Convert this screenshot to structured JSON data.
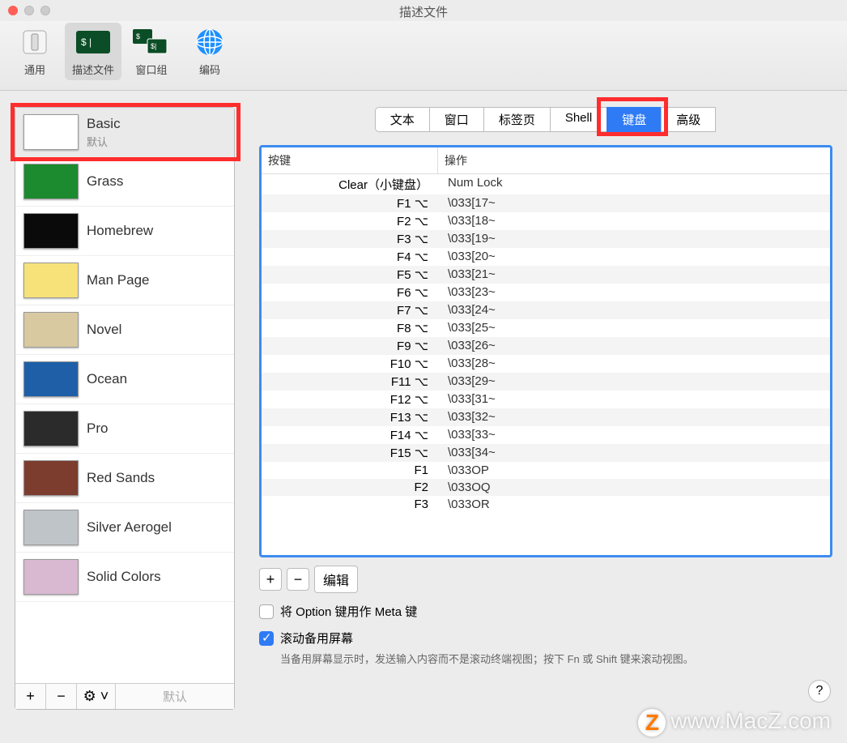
{
  "window": {
    "title": "描述文件"
  },
  "toolbar": {
    "general": "通用",
    "profiles": "描述文件",
    "windowgroups": "窗口组",
    "encoding": "编码"
  },
  "sidebar": {
    "profiles": [
      {
        "name": "Basic",
        "sub": "默认",
        "color": "#ffffff"
      },
      {
        "name": "Grass",
        "sub": "",
        "color": "#1c8a2e"
      },
      {
        "name": "Homebrew",
        "sub": "",
        "color": "#0a0a0a"
      },
      {
        "name": "Man Page",
        "sub": "",
        "color": "#f7e27a"
      },
      {
        "name": "Novel",
        "sub": "",
        "color": "#d8c9a0"
      },
      {
        "name": "Ocean",
        "sub": "",
        "color": "#1e5fa8"
      },
      {
        "name": "Pro",
        "sub": "",
        "color": "#2b2b2b"
      },
      {
        "name": "Red Sands",
        "sub": "",
        "color": "#7c3c2e"
      },
      {
        "name": "Silver Aerogel",
        "sub": "",
        "color": "#bfc4c9"
      },
      {
        "name": "Solid Colors",
        "sub": "",
        "color": "#d9b8d1"
      }
    ],
    "default_button": "默认",
    "actions_dropdown": "⚙︎"
  },
  "tabs": {
    "items": [
      "文本",
      "窗口",
      "标签页",
      "Shell",
      "键盘",
      "高级"
    ],
    "active_index": 4
  },
  "table": {
    "header_key": "按键",
    "header_action": "操作",
    "rows": [
      {
        "key": "Clear（小键盘）",
        "action": "Num Lock"
      },
      {
        "key": "F1 ⌥",
        "action": "\\033[17~"
      },
      {
        "key": "F2 ⌥",
        "action": "\\033[18~"
      },
      {
        "key": "F3 ⌥",
        "action": "\\033[19~"
      },
      {
        "key": "F4 ⌥",
        "action": "\\033[20~"
      },
      {
        "key": "F5 ⌥",
        "action": "\\033[21~"
      },
      {
        "key": "F6 ⌥",
        "action": "\\033[23~"
      },
      {
        "key": "F7 ⌥",
        "action": "\\033[24~"
      },
      {
        "key": "F8 ⌥",
        "action": "\\033[25~"
      },
      {
        "key": "F9 ⌥",
        "action": "\\033[26~"
      },
      {
        "key": "F10 ⌥",
        "action": "\\033[28~"
      },
      {
        "key": "F11 ⌥",
        "action": "\\033[29~"
      },
      {
        "key": "F12 ⌥",
        "action": "\\033[31~"
      },
      {
        "key": "F13 ⌥",
        "action": "\\033[32~"
      },
      {
        "key": "F14 ⌥",
        "action": "\\033[33~"
      },
      {
        "key": "F15 ⌥",
        "action": "\\033[34~"
      },
      {
        "key": "F1",
        "action": "\\033OP"
      },
      {
        "key": "F2",
        "action": "\\033OQ"
      },
      {
        "key": "F3",
        "action": "\\033OR"
      }
    ],
    "edit_button": "编辑"
  },
  "checks": {
    "option_meta": "将 Option 键用作 Meta 键",
    "scroll_alt": "滚动备用屏幕",
    "scroll_hint": "当备用屏幕显示时，发送输入内容而不是滚动终端视图；按下 Fn 或 Shift 键来滚动视图。"
  },
  "watermark": "www.MacZ.com",
  "watermark_badge": "Z"
}
